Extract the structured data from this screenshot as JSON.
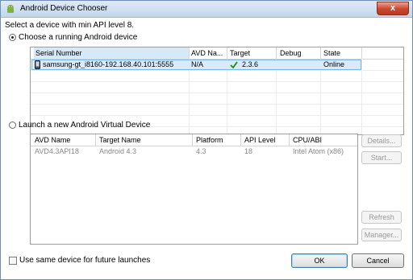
{
  "window": {
    "title": "Android Device Chooser",
    "close_glyph": "x"
  },
  "prompt": "Select a device with min API level 8.",
  "running": {
    "radio_label": "Choose a running Android device",
    "selected": true,
    "columns": [
      "Serial Number",
      "AVD Na...",
      "Target",
      "Debug",
      "State"
    ],
    "rows": [
      {
        "serial": "samsung-gt_i8160-192.168.40.101:5555",
        "avd": "N/A",
        "target": "2.3.6",
        "debug": "",
        "state": "Online"
      }
    ]
  },
  "launch": {
    "radio_label": "Launch a new Android Virtual Device",
    "selected": false,
    "columns": [
      "AVD Name",
      "Target Name",
      "Platform",
      "API Level",
      "CPU/ABI"
    ],
    "rows": [
      {
        "avd_name": "AVD4.3API18",
        "target_name": "Android 4.3",
        "platform": "4.3",
        "api_level": "18",
        "cpu_abi": "Intel Atom (x86)"
      }
    ],
    "buttons": {
      "details": "Details...",
      "start": "Start...",
      "refresh": "Refresh",
      "manager": "Manager..."
    }
  },
  "footer": {
    "checkbox_label": "Use same device for future launches",
    "checked": false,
    "ok": "OK",
    "cancel": "Cancel"
  },
  "colors": {
    "accent": "#3c7fb1",
    "selection": "#d9ebfa",
    "check": "#2a9a1f"
  },
  "icons": {
    "title": "android-icon",
    "device": "phone-icon",
    "target_ok": "checkmark-icon"
  }
}
